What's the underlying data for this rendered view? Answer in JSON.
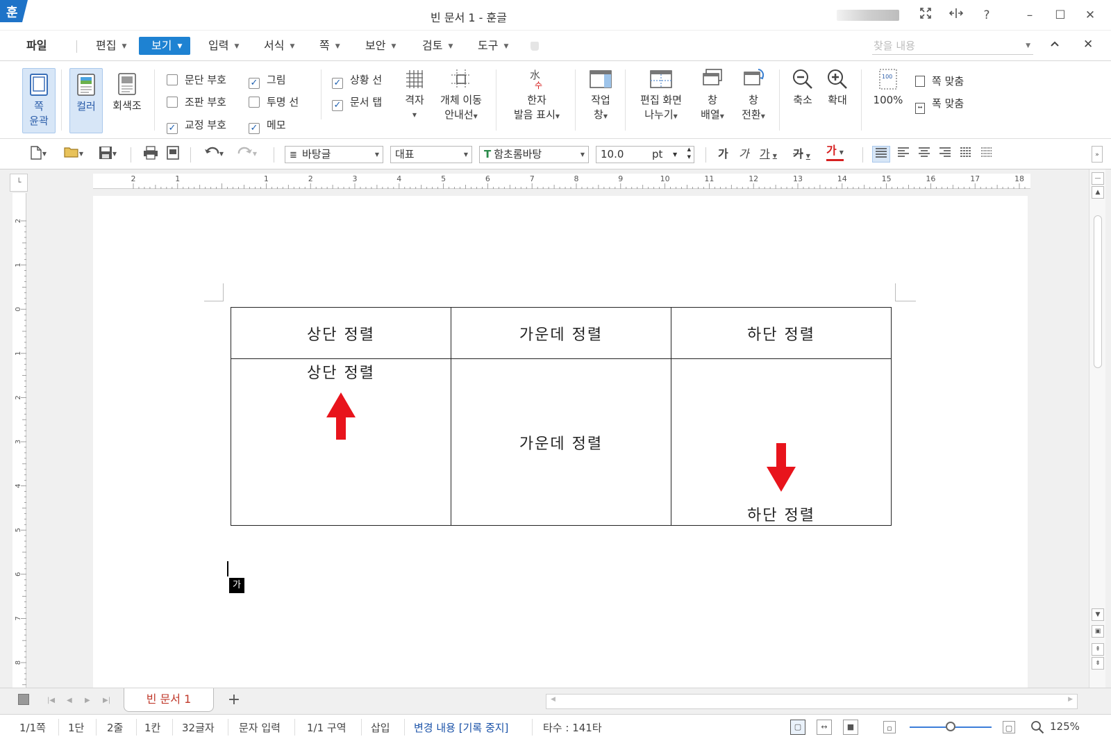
{
  "title_bar": {
    "logo": "훈",
    "title": "빈 문서 1 - 훈글",
    "controls": [
      "expand-icon",
      "split-icon",
      "help-icon",
      "minimize-icon",
      "maximize-icon",
      "close-icon"
    ],
    "help": "?",
    "minimize": "–",
    "maximize": "☐",
    "close": "✕"
  },
  "menu": {
    "items": [
      {
        "label": "파일",
        "has_arrow": false
      },
      {
        "label": "편집",
        "has_arrow": true
      },
      {
        "label": "보기",
        "has_arrow": true,
        "active": true
      },
      {
        "label": "입력",
        "has_arrow": true
      },
      {
        "label": "서식",
        "has_arrow": true
      },
      {
        "label": "쪽",
        "has_arrow": true
      },
      {
        "label": "보안",
        "has_arrow": true
      },
      {
        "label": "검토",
        "has_arrow": true
      },
      {
        "label": "도구",
        "has_arrow": true
      }
    ],
    "search_placeholder": "찾을 내용",
    "collapse": "^",
    "close": "✕"
  },
  "ribbon": {
    "page_outline": {
      "line1": "쪽",
      "line2": "윤곽"
    },
    "color": "컬러",
    "grayscale": "회색조",
    "checkboxes": [
      {
        "label": "문단 부호",
        "checked": false
      },
      {
        "label": "조판 부호",
        "checked": false
      },
      {
        "label": "교정 부호",
        "checked": true
      },
      {
        "label": "그림",
        "checked": true
      },
      {
        "label": "투명 선",
        "checked": false
      },
      {
        "label": "메모",
        "checked": true
      },
      {
        "label": "상황 선",
        "checked": true
      },
      {
        "label": "문서 탭",
        "checked": true
      }
    ],
    "grid": "격자",
    "object_guide": {
      "line1": "개체 이동",
      "line2": "안내선"
    },
    "hanja": {
      "line1": "한자",
      "line2": "발음 표시"
    },
    "task_pane": {
      "line1": "작업",
      "line2": "창"
    },
    "split_view": {
      "line1": "편집 화면",
      "line2": "나누기"
    },
    "arrange": {
      "line1": "창",
      "line2": "배열"
    },
    "switch": {
      "line1": "창",
      "line2": "전환"
    },
    "zoom_out": "축소",
    "zoom_in": "확대",
    "zoom_100": "100%",
    "fit_page": "쪽 맞춤",
    "fit_width": "폭 맞춤"
  },
  "toolbar": {
    "style": "바탕글",
    "lang": "대표",
    "font": "함초롬바탕",
    "size": "10.0",
    "unit": "pt",
    "bold": "가",
    "italic": "가",
    "underline": "가",
    "strike": "가",
    "color": "가"
  },
  "ruler": {
    "h_ticks": [
      "2",
      "1",
      "",
      "1",
      "2",
      "3",
      "4",
      "5",
      "6",
      "7",
      "8",
      "9",
      "10",
      "11",
      "12",
      "13",
      "14",
      "15",
      "16",
      "17",
      "18"
    ],
    "v_ticks": [
      "2",
      "1",
      "0",
      "1",
      "2",
      "3",
      "4",
      "5",
      "6",
      "7",
      "8"
    ]
  },
  "document": {
    "table": {
      "headers": [
        "상단 정렬",
        "가운데 정렬",
        "하단 정렬"
      ],
      "cells": [
        "상단 정렬",
        "가운데 정렬",
        "하단 정렬"
      ]
    },
    "ime_indicator": "가"
  },
  "tabs": {
    "doc_tab": "빈 문서 1",
    "add": "+"
  },
  "status": {
    "page": "1/1쪽",
    "column": "1단",
    "line": "2줄",
    "char_col": "1칸",
    "chars": "32글자",
    "mode": "문자 입력",
    "section": "1/1 구역",
    "insert": "삽입",
    "track_changes": "변경 내용 [기록 중지]",
    "keystrokes": "타수 : 141타",
    "zoom": "125%",
    "zoom_level": 0.5
  },
  "colors": {
    "accent": "#1e82d2",
    "arrow_red": "#e8141c",
    "tab_text": "#c0392b"
  }
}
